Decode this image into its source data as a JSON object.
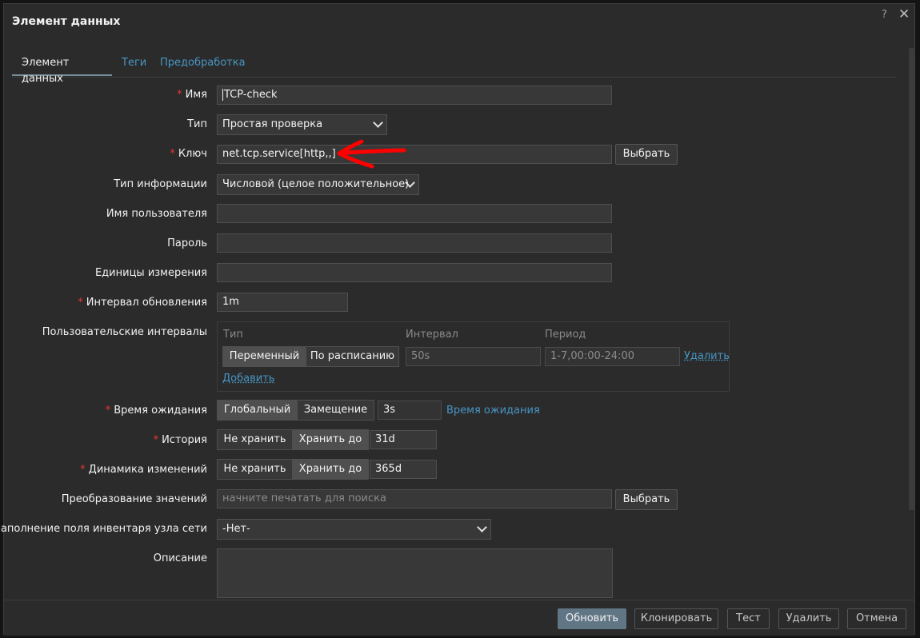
{
  "dialog": {
    "title": "Элемент данных",
    "help": "?",
    "close": "✕"
  },
  "tabs": [
    {
      "label": "Элемент данных"
    },
    {
      "label": "Теги"
    },
    {
      "label": "Предобработка"
    }
  ],
  "form": {
    "name": {
      "label": "Имя",
      "value": "TCP-check"
    },
    "type": {
      "label": "Тип",
      "value": "Простая проверка"
    },
    "key": {
      "label": "Ключ",
      "value": "net.tcp.service[http,,]",
      "button": "Выбрать"
    },
    "info_type": {
      "label": "Тип информации",
      "value": "Числовой (целое положительное)"
    },
    "username": {
      "label": "Имя пользователя",
      "value": ""
    },
    "password": {
      "label": "Пароль",
      "value": ""
    },
    "units": {
      "label": "Единицы измерения",
      "value": ""
    },
    "delay": {
      "label": "Интервал обновления",
      "value": "1m"
    },
    "custom_intervals": {
      "label": "Пользовательские интервалы",
      "col_type": "Тип",
      "col_interval": "Интервал",
      "col_period": "Период",
      "seg_flexible": "Переменный",
      "seg_scheduling": "По расписанию",
      "interval_value": "50s",
      "period_value": "1-7,00:00-24:00",
      "remove": "Удалить",
      "add": "Добавить"
    },
    "timeout": {
      "label": "Время ожидания",
      "seg_global": "Глобальный",
      "seg_override": "Замещение",
      "value": "3s",
      "link": "Время ожидания"
    },
    "history": {
      "label": "История",
      "seg_no": "Не хранить",
      "seg_keep": "Хранить до",
      "value": "31d"
    },
    "trends": {
      "label": "Динамика изменений",
      "seg_no": "Не хранить",
      "seg_keep": "Хранить до",
      "value": "365d"
    },
    "valuemap": {
      "label": "Преобразование значений",
      "placeholder": "начните печатать для поиска",
      "button": "Выбрать"
    },
    "inventory": {
      "label": "Заполнение поля инвентаря узла сети",
      "value": "-Нет-"
    },
    "description": {
      "label": "Описание",
      "value": ""
    }
  },
  "footer": {
    "update": "Обновить",
    "clone": "Клонировать",
    "test": "Тест",
    "delete": "Удалить",
    "cancel": "Отмена"
  },
  "colors": {
    "accent": "#4796c4",
    "required": "#e33734",
    "primary_button": "#617685",
    "annotation_arrow": "#ff0000"
  }
}
